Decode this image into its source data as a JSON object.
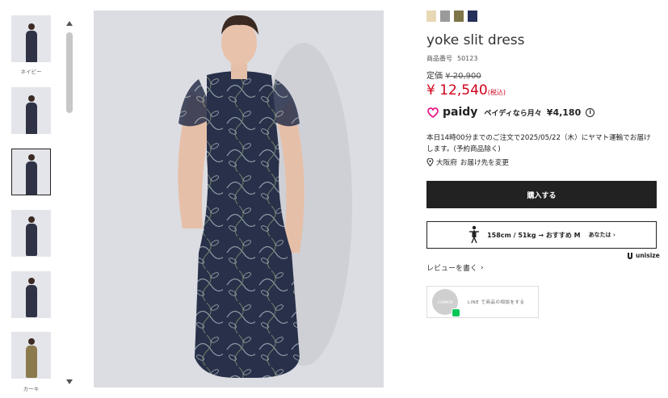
{
  "gallery": {
    "thumbnails": [
      {
        "caption": "ネイビー",
        "dress_color": "#2f3345"
      },
      {
        "caption": "",
        "dress_color": "#2f3345"
      },
      {
        "caption": "",
        "dress_color": "#2f3345"
      },
      {
        "caption": "",
        "dress_color": "#2f3345"
      },
      {
        "caption": "",
        "dress_color": "#2f3345"
      },
      {
        "caption": "カーキ",
        "dress_color": "#8b7a4e"
      }
    ],
    "active_index": 2
  },
  "product": {
    "swatch_colors": [
      "#e8d8b6",
      "#9a9a9a",
      "#7d7548",
      "#25305a"
    ],
    "title": "yoke slit dress",
    "sku_label": "商品番号",
    "sku": "50123",
    "list_price_label": "定価",
    "list_price": "¥ 20,900",
    "sale_price": "¥ 12,540",
    "tax_note": "(税込)",
    "accent_color": "#d0021b"
  },
  "paidy": {
    "logo_text": "paidy",
    "monthly_label": "ペイディなら月々",
    "monthly_amount": "¥4,180",
    "info_glyph": "i",
    "brand_color": "#e5087e"
  },
  "delivery": {
    "message": "本日14時00分までのご注文で2025/05/22（木）にヤマト運輸でお届けします。(予約商品除く)",
    "prefecture": "大阪府",
    "change_link": "お届け先を変更"
  },
  "actions": {
    "buy_label": "購入する"
  },
  "size_recommend": {
    "summary": "158cm / 51kg → おすすめ M",
    "link": "あなたは",
    "chevron": "›",
    "brand": "unisize"
  },
  "review": {
    "link": "レビューを書く",
    "chevron": "›"
  },
  "line_consult": {
    "avatar_label": "COMMON",
    "text": "LINE で商品の相談をする"
  }
}
